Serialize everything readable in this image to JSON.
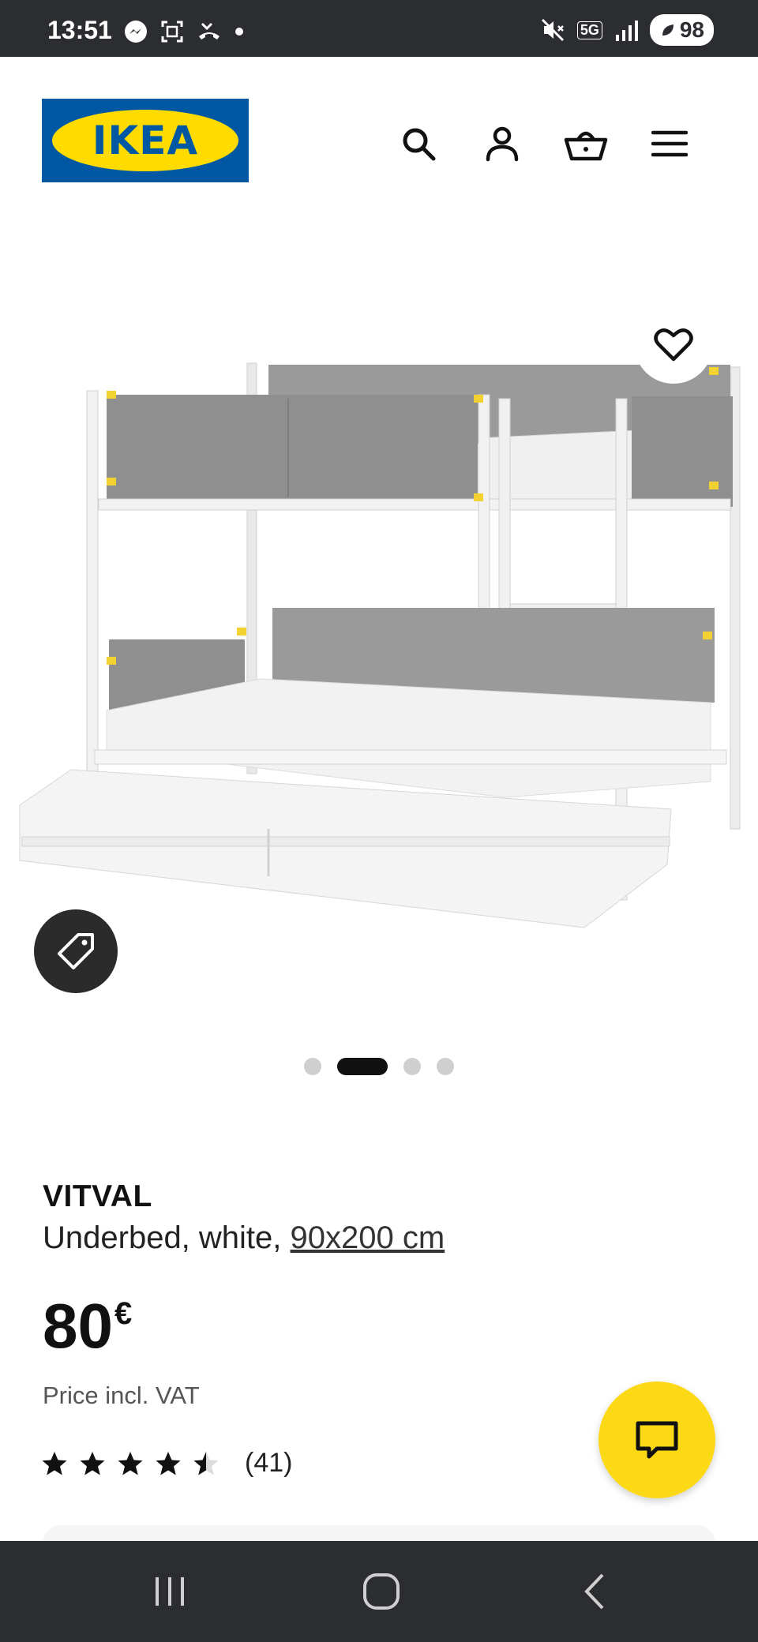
{
  "status_bar": {
    "time": "13:51",
    "network": "5G",
    "battery": "98",
    "icons": [
      "messenger-icon",
      "screenshot-icon",
      "missed-call-icon",
      "dot-icon",
      "mute-icon",
      "signal-icon",
      "battery-icon"
    ]
  },
  "header": {
    "logo_text": "IKEA",
    "icons": [
      "search-icon",
      "account-icon",
      "basket-icon",
      "menu-icon"
    ],
    "colors": {
      "logo_blue": "#0058a3",
      "logo_yellow": "#ffdb00"
    }
  },
  "gallery": {
    "image_count": 4,
    "active_index": 1
  },
  "product": {
    "name": "VITVAL",
    "description": "Underbed, white, ",
    "size": "90x200 cm",
    "price": "80",
    "currency": "€",
    "price_note": "Price incl. VAT",
    "rating": 4.5,
    "review_count": "(41)"
  },
  "chat": {
    "color": "#fbd914"
  }
}
